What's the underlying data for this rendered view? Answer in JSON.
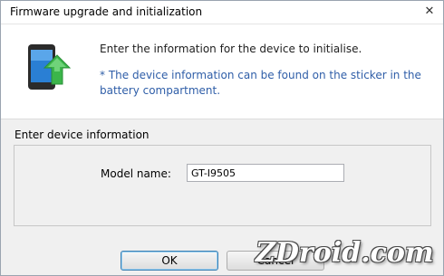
{
  "window": {
    "title": "Firmware upgrade and initialization",
    "close_glyph": "✕"
  },
  "header": {
    "icon": "phone-upgrade-icon",
    "message": "Enter the information for the device to initialise.",
    "note": "* The device information can be found on the sticker in the battery compartment."
  },
  "form": {
    "section_label": "Enter device information",
    "model_label": "Model name:",
    "model_value": "GT-I9505"
  },
  "buttons": {
    "ok_label": "OK",
    "cancel_label": "Cancel"
  },
  "watermark": {
    "text": "ZDroid.com"
  },
  "colors": {
    "note_text": "#2f5ea8",
    "arrow": "#3bb54a",
    "phone_body": "#2b2b2b",
    "phone_screen": "#2a7fd4"
  }
}
